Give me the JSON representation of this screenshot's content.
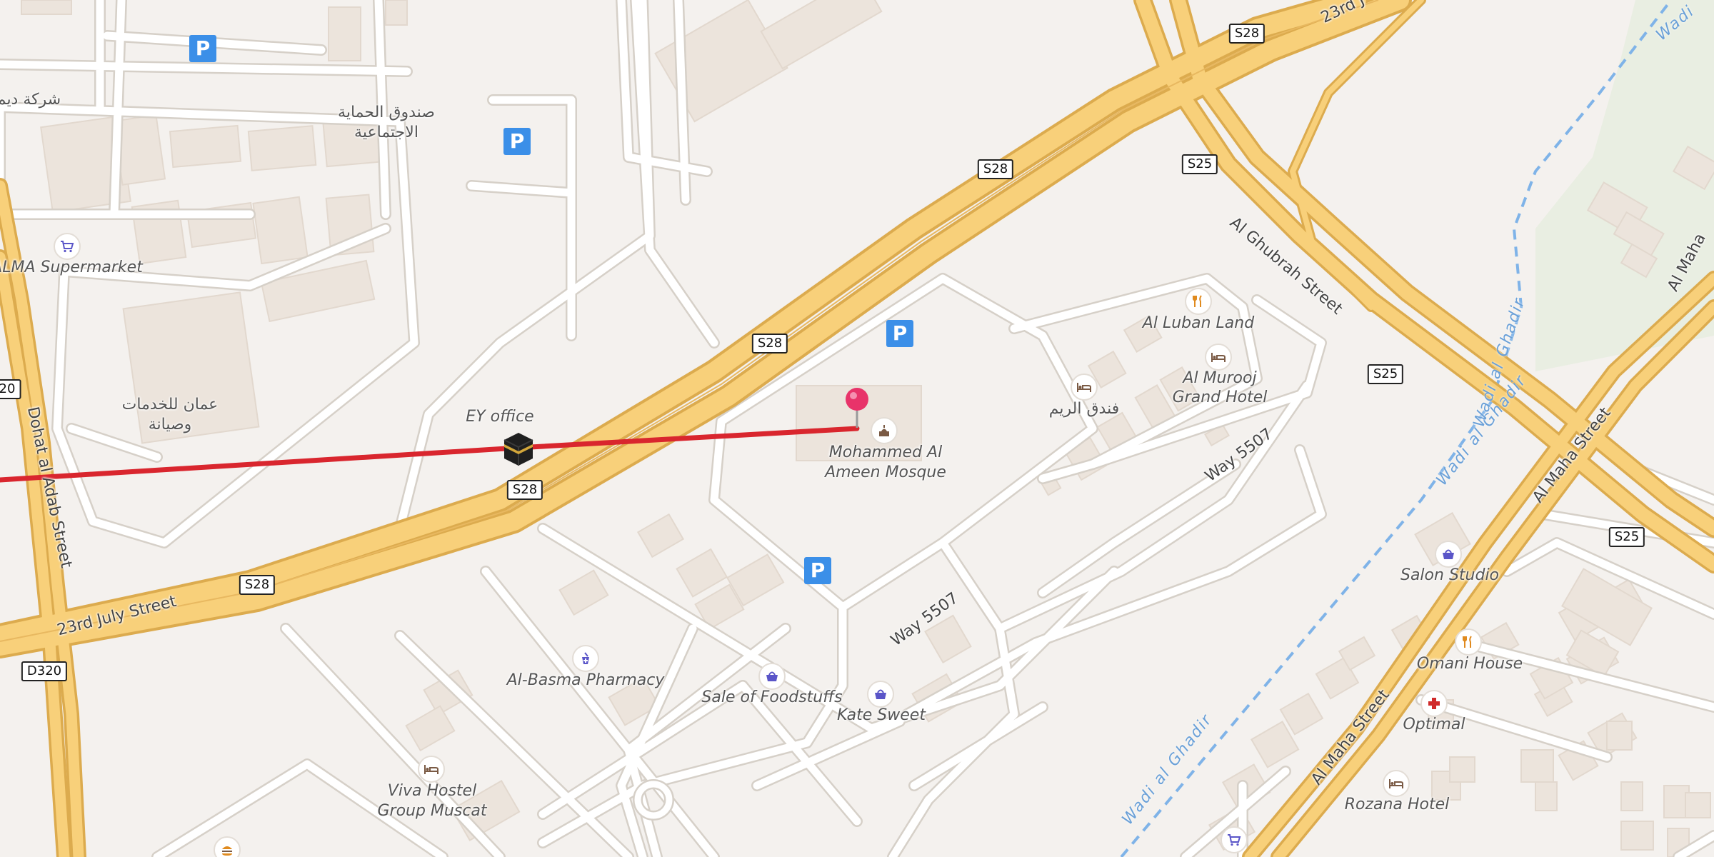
{
  "map": {
    "colors": {
      "background": "#f4f1ee",
      "highway": "#f8d07a",
      "route": "#d9262e",
      "parking": "#3b8fe8",
      "pin": "#e8336a",
      "water": "#6aa0d8"
    },
    "route_line": {
      "color": "#d9262e"
    },
    "selected_pin": {
      "icon": "map-pin-icon"
    },
    "kaaba_marker": {
      "icon": "kaaba-icon"
    },
    "road_shields": {
      "s28_a": "S28",
      "s28_b": "S28",
      "s28_c": "S28",
      "s28_d": "S28",
      "s28_e": "S28",
      "s25_a": "S25",
      "s25_b": "S25",
      "s25_c": "S25",
      "d320": "D320",
      "r20": "20"
    },
    "street_labels": {
      "july23": "23rd July Street",
      "july23_top": "23rd J",
      "dohat": "Dohat al Adab Street",
      "ghubrah": "Al Ghubrah Street",
      "way5507_a": "Way 5507",
      "way5507_b": "Way 5507",
      "maha_a": "Al Maha Street",
      "maha_b": "Al Maha Street",
      "maha_c": "Al Maha",
      "wadi_a": "Wadi al Ghadir",
      "wadi_b": "Wadi al Ghadir",
      "wadi_c": "Wadi al Ghadir",
      "wadi_d": "Wadi"
    },
    "place_labels": {
      "sharikat_deem": "شركة ديم",
      "sanduq_line1": "صندوق الحماية",
      "sanduq_line2": "الاجتماعية",
      "alma": "ALMA Supermarket",
      "oman_line1": "عمان للخدمات",
      "oman_line2": "وصيانة",
      "ey_office": "EY office",
      "mosque_line1": "Mohammed Al",
      "mosque_line2": "Ameen Mosque",
      "luban": "Al Luban Land",
      "murooj_line1": "Al Murooj",
      "murooj_line2": "Grand Hotel",
      "reem_hotel": "فندق الريم",
      "basma": "Al-Basma Pharmacy",
      "foodstuffs": "Sale of Foodstuffs",
      "kate": "Kate Sweet",
      "viva_line1": "Viva Hostel",
      "viva_line2": "Group Muscat",
      "salon": "Salon Studio",
      "omani_house": "Omani House",
      "optimal": "Optimal",
      "rozana": "Rozana Hotel"
    },
    "poi_icons": {
      "alma": "shopping-cart-icon",
      "mosque": "mosque-icon",
      "luban": "restaurant-icon",
      "murooj": "hotel-bed-icon",
      "reem": "hotel-bed-icon",
      "basma": "pharmacy-icon",
      "foodstuffs": "shopping-basket-icon",
      "kate": "shopping-basket-icon",
      "viva": "hotel-bed-icon",
      "salon": "shopping-basket-icon",
      "omani_house": "restaurant-icon",
      "optimal": "medical-cross-icon",
      "rozana": "hotel-bed-icon",
      "bottom_cart": "shopping-cart-icon",
      "bottom_burger": "fast-food-icon"
    },
    "parking": {
      "symbol": "P"
    }
  }
}
